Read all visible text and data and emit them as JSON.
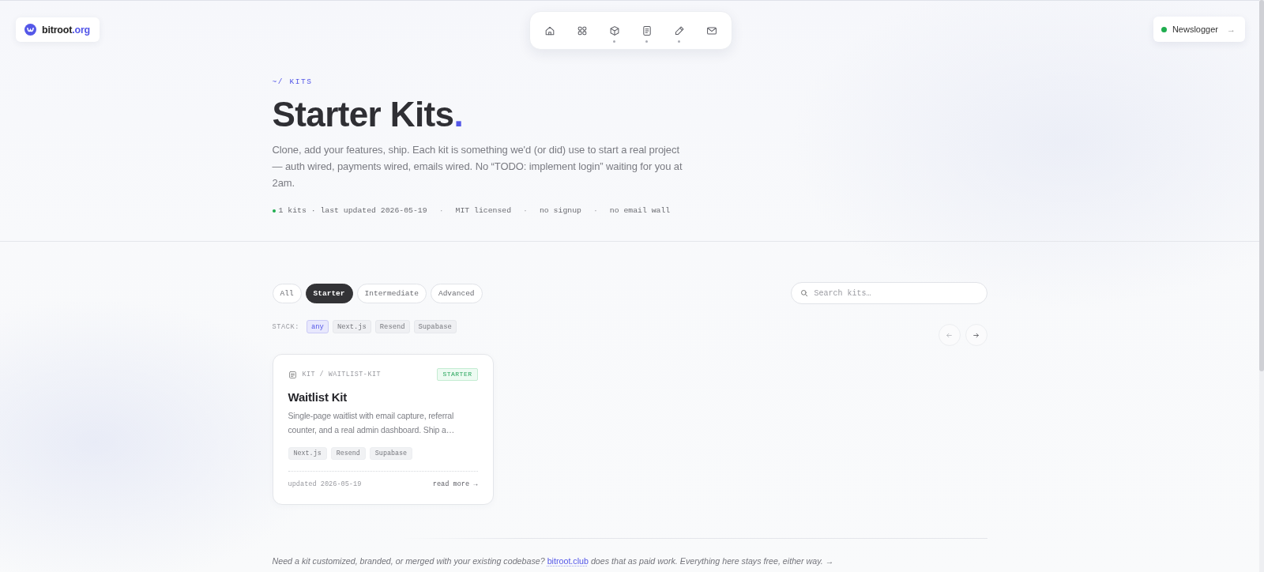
{
  "logo": {
    "name": "bitroot",
    "tld": ".org"
  },
  "nav": [
    {
      "dot": false
    },
    {
      "dot": false
    },
    {
      "dot": true
    },
    {
      "dot": true
    },
    {
      "dot": true
    },
    {
      "dot": false
    }
  ],
  "newsletter_button": {
    "label": "Newslogger",
    "arrow": "→"
  },
  "hero": {
    "breadcrumb": "~/ KITS",
    "title": "Starter Kits",
    "title_accent": ".",
    "description": "Clone, add your features, ship. Each kit is something we'd (or did) use to start a real project — auth wired, payments wired, emails wired. No “TODO: implement login” waiting for you at 2am.",
    "meta": [
      "1 kits · last updated 2026-05-19",
      "·",
      "MIT licensed",
      "·",
      "no signup",
      "·",
      "no email wall"
    ]
  },
  "filters": [
    {
      "label": "All",
      "selected": false
    },
    {
      "label": "Starter",
      "selected": true
    },
    {
      "label": "Intermediate",
      "selected": false
    },
    {
      "label": "Advanced",
      "selected": false
    }
  ],
  "search": {
    "placeholder": "Search kits…"
  },
  "stack": {
    "label": "STACK:",
    "options": [
      {
        "label": "any",
        "selected": true
      },
      {
        "label": "Next.js",
        "selected": false
      },
      {
        "label": "Resend",
        "selected": false
      },
      {
        "label": "Supabase",
        "selected": false
      }
    ]
  },
  "pager": {
    "prev": {
      "disabled": true
    },
    "next": {
      "disabled": false
    }
  },
  "kits": [
    {
      "path": "KIT / WAITLIST-KIT",
      "tier": "STARTER",
      "title": "Waitlist Kit",
      "description": "Single-page waitlist with email capture, referral counter, and a real admin dashboard. Ship a…",
      "tags": [
        "Next.js",
        "Resend",
        "Supabase"
      ],
      "updated": "updated 2026-05-19",
      "link": "read more →"
    }
  ],
  "footer": {
    "before": "Need a kit customized, branded, or merged with your existing codebase?",
    "link": "bitroot.club",
    "after": "does that as paid work. Everything here stays free, either way. →"
  }
}
